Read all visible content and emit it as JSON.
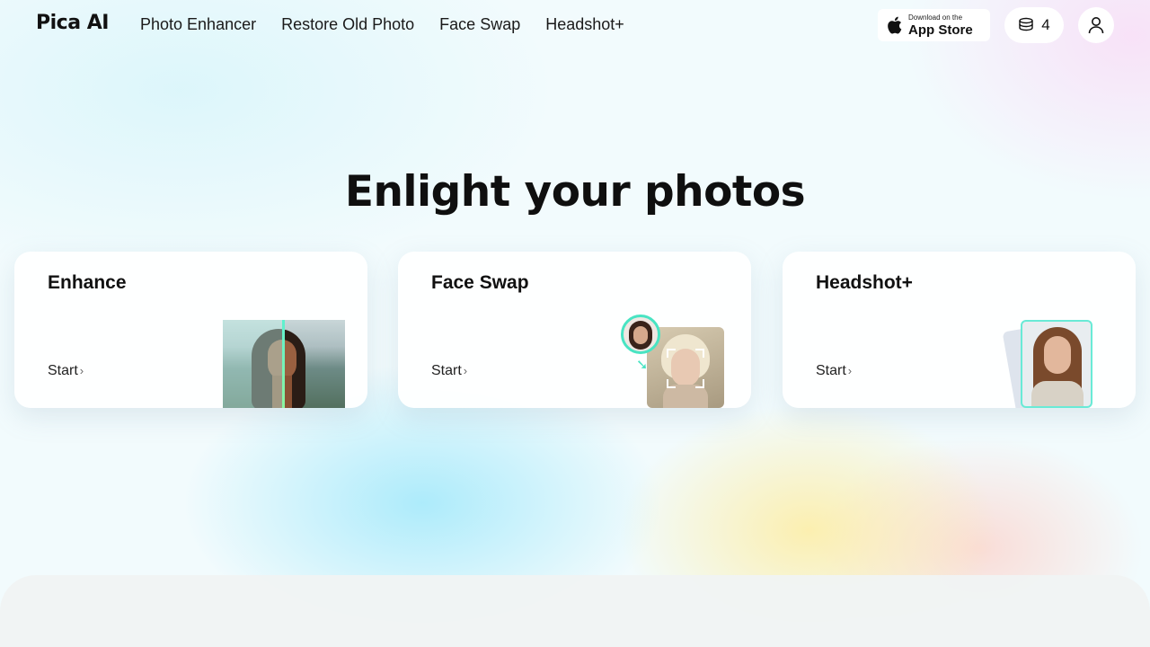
{
  "nav": {
    "logo": "Pica AI",
    "links": [
      "Photo Enhancer",
      "Restore Old Photo",
      "Face Swap",
      "Headshot+"
    ],
    "appstore": {
      "small": "Download on the",
      "big": "App Store"
    },
    "credits": "4"
  },
  "hero": {
    "title": "Enlight your photos"
  },
  "cards": [
    {
      "title": "Enhance",
      "cta": "Start"
    },
    {
      "title": "Face Swap",
      "cta": "Start"
    },
    {
      "title": "Headshot+",
      "cta": "Start"
    }
  ],
  "icons": [
    "apple-icon",
    "coins-icon",
    "user-icon",
    "chevron-right-icon",
    "arrow-down-icon"
  ],
  "colors": {
    "accent": "#49e4c3",
    "text": "#111111"
  }
}
